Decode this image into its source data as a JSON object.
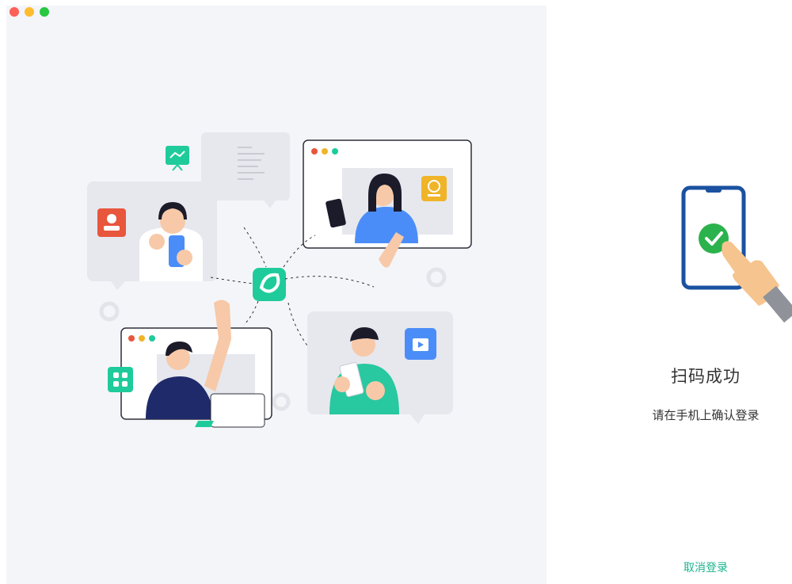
{
  "window": {
    "controls": [
      {
        "name": "close",
        "color": "#fe5f57"
      },
      {
        "name": "minimize",
        "color": "#febc2e"
      },
      {
        "name": "zoom",
        "color": "#28c840"
      }
    ]
  },
  "illustration": {
    "center_logo_icon": "app-logo-icon",
    "colors": {
      "brand": "#1fcb9b",
      "blue": "#4b8df8",
      "orange": "#f0b429",
      "red": "#e8563c",
      "navy": "#1f2a6b"
    }
  },
  "login": {
    "status_icon": "phone-check-icon",
    "status_title": "扫码成功",
    "status_subtitle": "请在手机上确认登录",
    "cancel_label": "取消登录",
    "accent_color": "#1cb38f"
  }
}
